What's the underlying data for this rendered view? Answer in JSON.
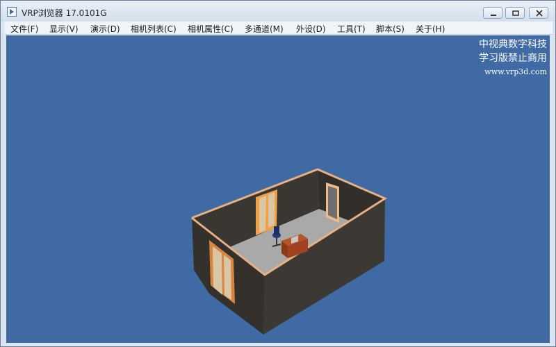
{
  "window": {
    "title": "VRP浏览器 17.0101G",
    "controls": [
      {
        "name": "minimize-button",
        "icon": "minimize-icon"
      },
      {
        "name": "restore-button",
        "icon": "restore-icon"
      },
      {
        "name": "close-button",
        "icon": "close-icon"
      }
    ]
  },
  "menu": {
    "items": [
      {
        "label": "文件(F)"
      },
      {
        "label": "显示(V)"
      },
      {
        "label": "演示(D)"
      },
      {
        "label": "相机列表(C)"
      },
      {
        "label": "相机属性(C)"
      },
      {
        "label": "多通道(M)"
      },
      {
        "label": "外设(D)"
      },
      {
        "label": "工具(T)"
      },
      {
        "label": "脚本(S)"
      },
      {
        "label": "关于(H)"
      }
    ]
  },
  "viewport": {
    "watermark_line1": "中视典数字科技",
    "watermark_line2": "学习版禁止商用",
    "watermark_url": "www.vrp3d.com",
    "scene": "3D room model with walls, doors, windows, desk and office chair",
    "colors": {
      "background": "#3f6aa3",
      "wall": "#3c3833",
      "wall_top": "#e8b083",
      "floor": "#a9a9a9",
      "door_frame": "#d9853e",
      "desk": "#a0421f"
    }
  }
}
